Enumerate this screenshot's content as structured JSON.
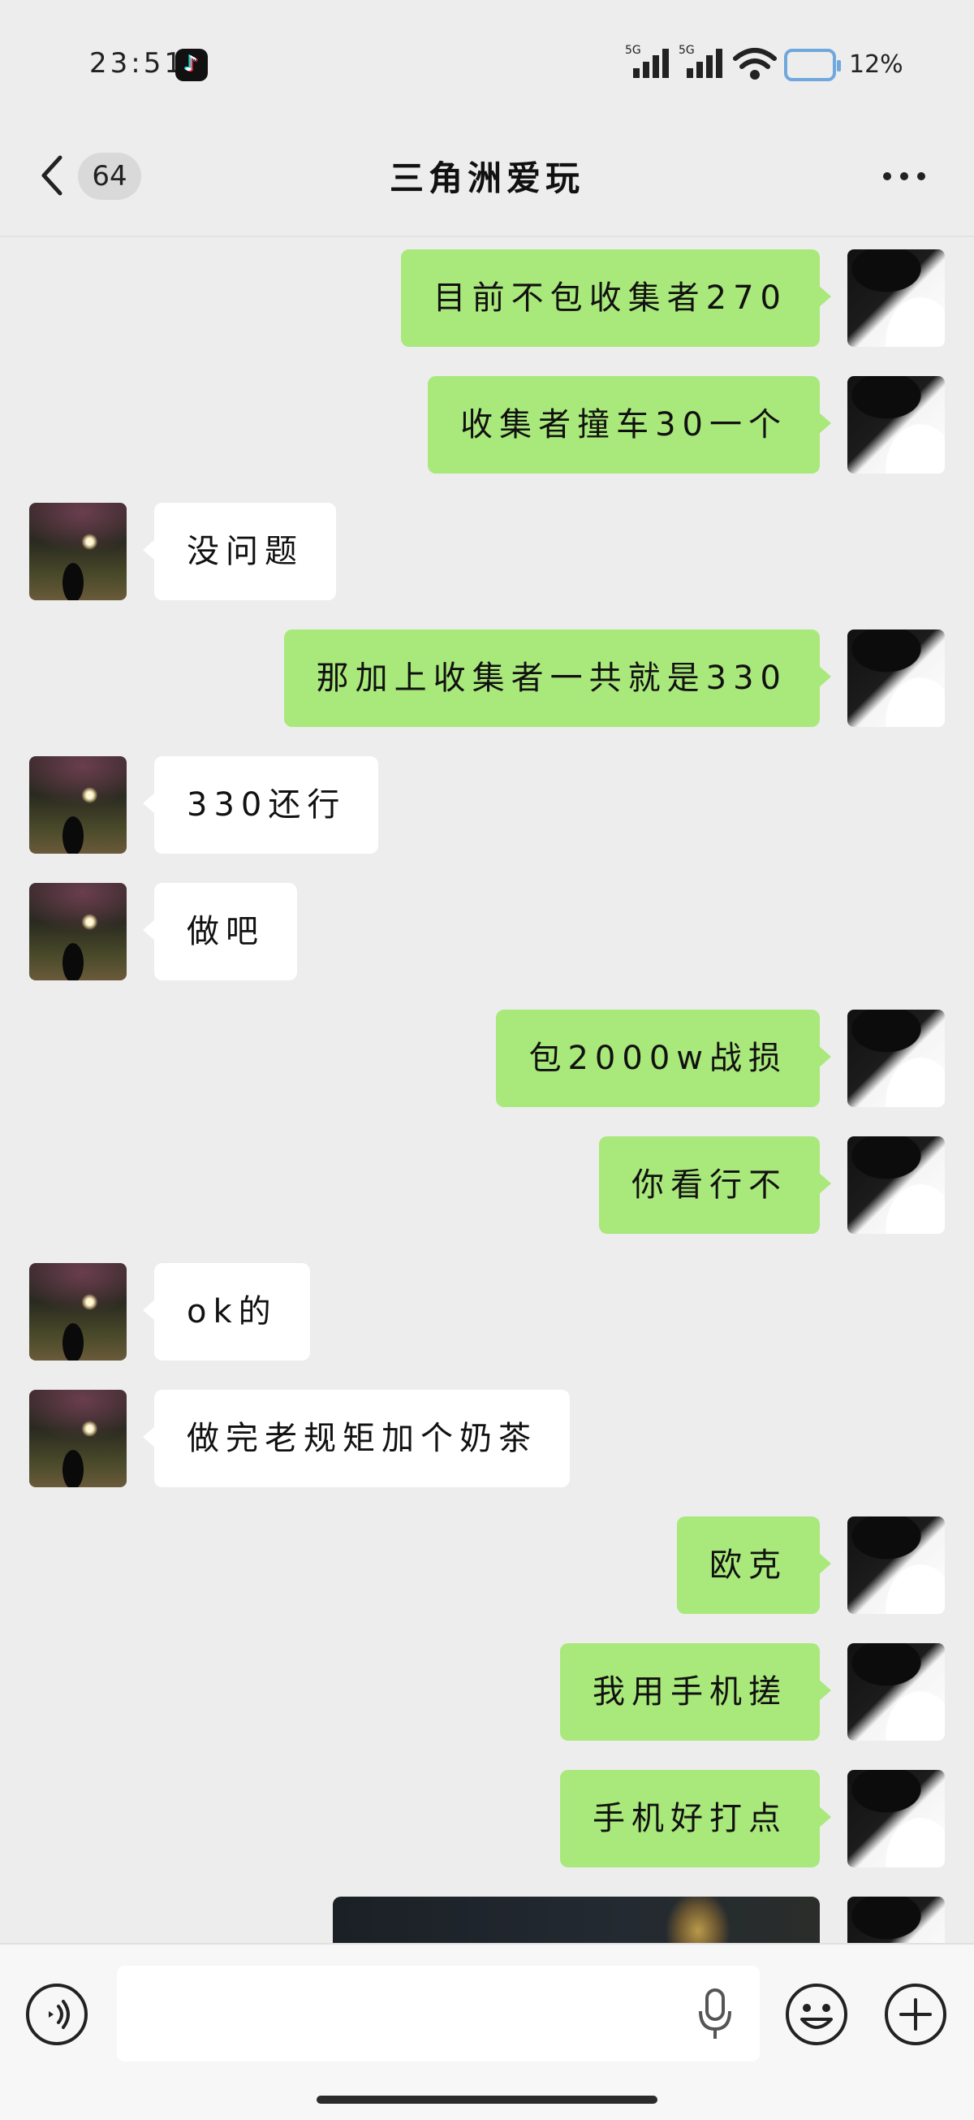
{
  "status_bar": {
    "time": "23:51",
    "signal_1_label": "5G",
    "signal_2_label": "5G",
    "battery_percent": "12%"
  },
  "header": {
    "unread_count": "64",
    "title": "三角洲爱玩"
  },
  "messages": [
    {
      "sender": "self",
      "text": "目前不包收集者270"
    },
    {
      "sender": "self",
      "text": "收集者撞车30一个"
    },
    {
      "sender": "other",
      "text": "没问题"
    },
    {
      "sender": "self",
      "text": "那加上收集者一共就是330"
    },
    {
      "sender": "other",
      "text": "330还行"
    },
    {
      "sender": "other",
      "text": "做吧"
    },
    {
      "sender": "self",
      "text": "包2000w战损"
    },
    {
      "sender": "self",
      "text": "你看行不"
    },
    {
      "sender": "other",
      "text": "ok的"
    },
    {
      "sender": "other",
      "text": "做完老规矩加个奶茶"
    },
    {
      "sender": "self",
      "text": "欧克"
    },
    {
      "sender": "self",
      "text": "我用手机搓"
    },
    {
      "sender": "self",
      "text": "手机好打点"
    },
    {
      "sender": "self",
      "type": "image"
    }
  ],
  "input": {
    "placeholder": ""
  },
  "colors": {
    "self_bubble": "#a9e87a",
    "other_bubble": "#ffffff",
    "background": "#ededed"
  },
  "icons": [
    "back-icon",
    "more-icon",
    "voice-icon",
    "mic-icon",
    "emoji-icon",
    "plus-icon",
    "wifi-icon",
    "battery-icon",
    "tiktok-icon"
  ]
}
